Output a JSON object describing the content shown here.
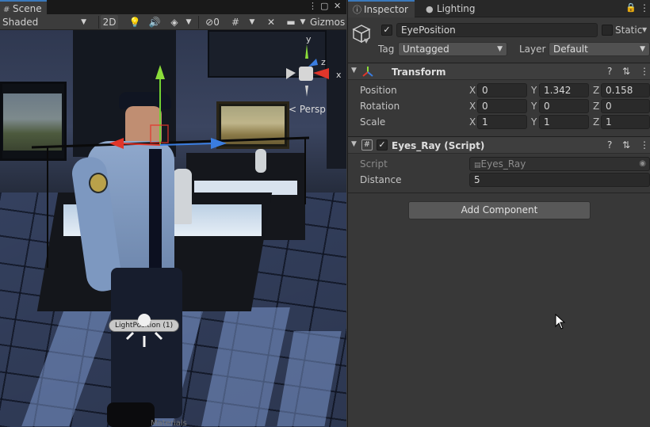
{
  "scene": {
    "tab_label": "Scene",
    "shading_mode": "Shaded",
    "toggle_2d": "2D",
    "hidden_count": "0",
    "gizmos_label": "Gizmos",
    "persp_label": "Persp",
    "axis_labels": {
      "y": "y",
      "z": "z",
      "x": "x"
    },
    "light_label": "LightPosition (1)",
    "bottom_peek": "Materials"
  },
  "inspector": {
    "tabs": [
      {
        "label": "Inspector",
        "active": true
      },
      {
        "label": "Lighting",
        "active": false
      }
    ],
    "object": {
      "active": true,
      "name": "EyePosition",
      "static_label": "Static",
      "tag_label": "Tag",
      "tag_value": "Untagged",
      "layer_label": "Layer",
      "layer_value": "Default"
    },
    "transform": {
      "title": "Transform",
      "rows": [
        {
          "label": "Position",
          "x": "0",
          "y": "1.342",
          "z": "0.158"
        },
        {
          "label": "Rotation",
          "x": "0",
          "y": "0",
          "z": "0"
        },
        {
          "label": "Scale",
          "x": "1",
          "y": "1",
          "z": "1"
        }
      ]
    },
    "script_component": {
      "enabled": true,
      "title": "Eyes_Ray (Script)",
      "script_label": "Script",
      "script_value": "Eyes_Ray",
      "distance_label": "Distance",
      "distance_value": "5"
    },
    "add_component_label": "Add Component"
  },
  "colors": {
    "tab_accent": "#3a79bb",
    "axis_x": "#e0362b",
    "axis_y": "#8bdc3a",
    "axis_z": "#3a7de0"
  }
}
